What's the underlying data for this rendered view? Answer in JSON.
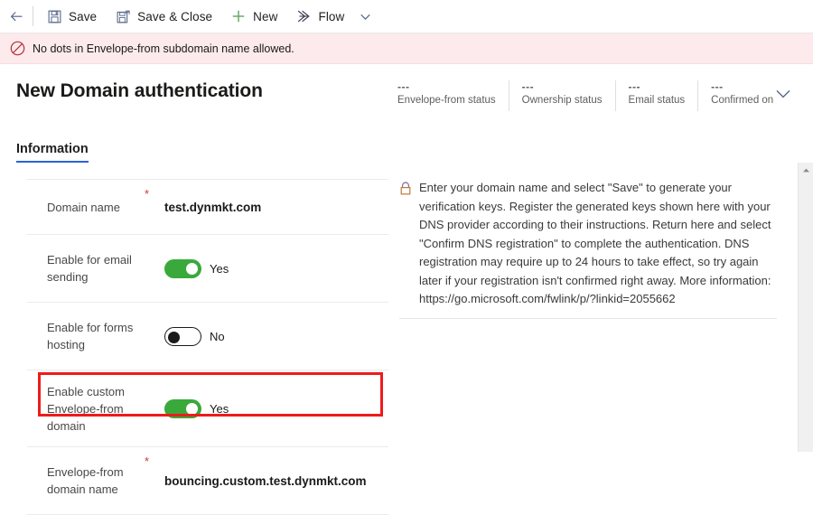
{
  "commandbar": {
    "back_label": "Back",
    "buttons": [
      {
        "id": "save",
        "label": "Save",
        "icon": "save-icon"
      },
      {
        "id": "save-close",
        "label": "Save & Close",
        "icon": "save-and-close-icon"
      },
      {
        "id": "new",
        "label": "New",
        "icon": "plus-icon"
      },
      {
        "id": "flow",
        "label": "Flow",
        "icon": "flow-icon"
      }
    ],
    "overflow_caret": "chevron-down-icon"
  },
  "notification": {
    "icon": "blocked-icon",
    "message": "No dots in Envelope-from subdomain name allowed.",
    "background": "#fdeaec"
  },
  "header": {
    "title": "New Domain authentication",
    "chevron": "chevron-down-icon",
    "statuses": [
      {
        "value": "---",
        "label": "Envelope-from status"
      },
      {
        "value": "---",
        "label": "Ownership status"
      },
      {
        "value": "---",
        "label": "Email status"
      },
      {
        "value": "---",
        "label": "Confirmed on"
      }
    ]
  },
  "tabs": [
    {
      "label": "Information",
      "active": true
    }
  ],
  "form": {
    "rows": [
      {
        "label": "Domain name",
        "required": "*",
        "type": "text",
        "value": "test.dynmkt.com"
      },
      {
        "label": "Enable for email sending",
        "required": "",
        "type": "toggle",
        "state": "on",
        "value": "Yes"
      },
      {
        "label": "Enable for forms hosting",
        "required": "",
        "type": "toggle",
        "state": "off",
        "value": "No"
      },
      {
        "label": "Enable custom Envelope-from domain",
        "required": "",
        "type": "toggle",
        "state": "on",
        "value": "Yes"
      },
      {
        "label": "Envelope-from domain name",
        "required": "*",
        "type": "text",
        "value": "bouncing.custom.test.dynmkt.com",
        "highlighted": true
      }
    ]
  },
  "info_panel": {
    "icon": "lock-icon",
    "text": "Enter your domain name and select \"Save\" to generate your verification keys. Register the generated keys shown here with your DNS provider according to their instructions. Return here and select \"Confirm DNS registration\" to complete the authentication. DNS registration may require up to 24 hours to take effect, so try again later if your registration isn't confirmed right away. More information: https://go.microsoft.com/fwlink/p/?linkid=2055662"
  },
  "scrollbar": {
    "up_arrow": "caret-up-icon"
  },
  "colors": {
    "accent": "#2b62d9",
    "toggle_on": "#3aa93c",
    "error_border": "#ee1b1b",
    "required_asterisk": "#d13438"
  }
}
